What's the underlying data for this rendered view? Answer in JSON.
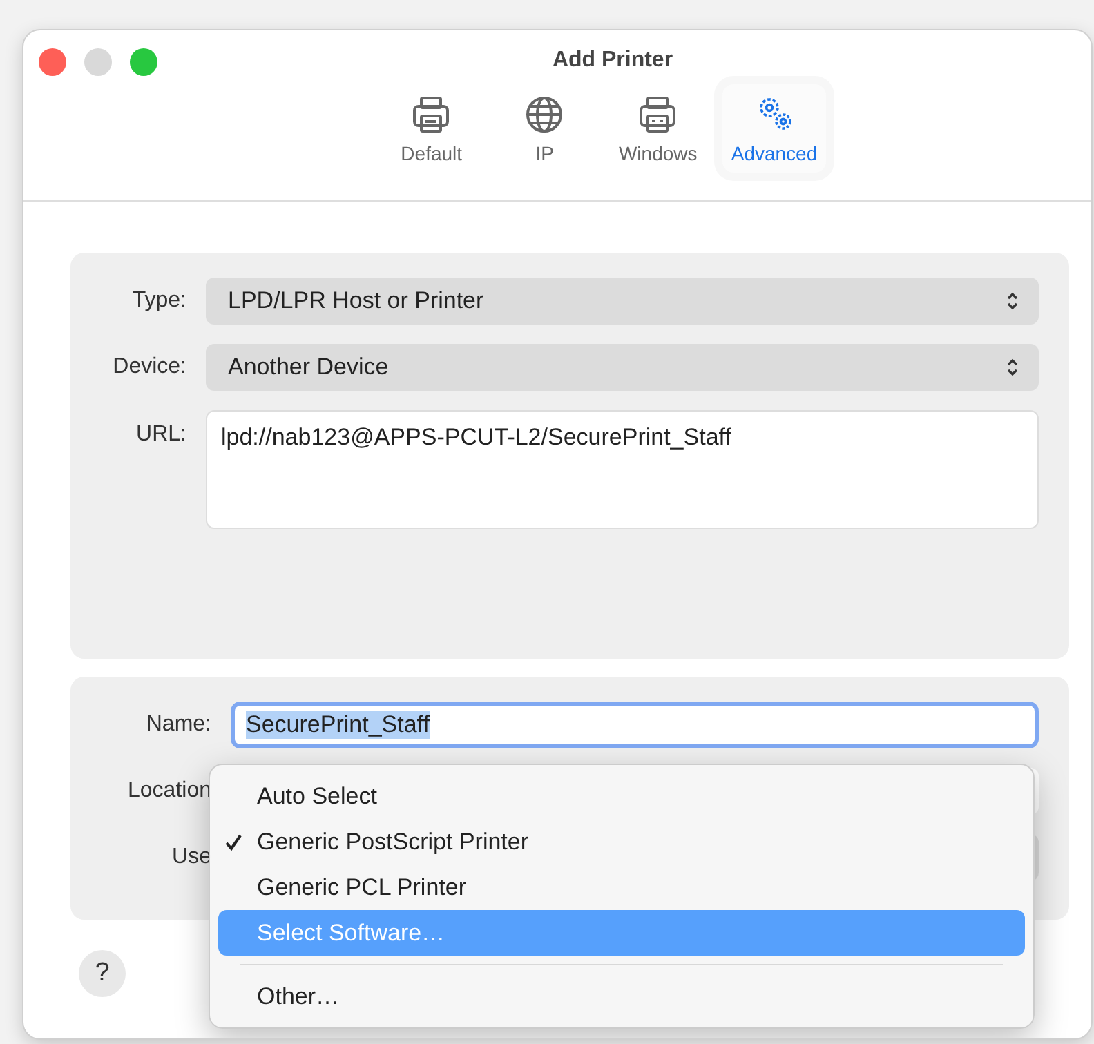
{
  "window": {
    "title": "Add Printer"
  },
  "tabs": [
    {
      "label": "Default",
      "selected": false
    },
    {
      "label": "IP",
      "selected": false
    },
    {
      "label": "Windows",
      "selected": false
    },
    {
      "label": "Advanced",
      "selected": true
    }
  ],
  "connection": {
    "type": {
      "label": "Type:",
      "value": "LPD/LPR Host or Printer"
    },
    "device": {
      "label": "Device:",
      "value": "Another Device"
    },
    "url": {
      "label": "URL:",
      "value": "lpd://nab123@APPS-PCUT-L2/SecurePrint_Staff"
    }
  },
  "details": {
    "name": {
      "label": "Name:",
      "value": "SecurePrint_Staff",
      "text_selected": true
    },
    "location": {
      "label": "Location"
    },
    "use": {
      "label": "Use"
    }
  },
  "menu": [
    {
      "kind": "option",
      "label": "Auto Select",
      "checked": false,
      "selected": false
    },
    {
      "kind": "option",
      "label": "Generic PostScript Printer",
      "checked": true,
      "selected": false
    },
    {
      "kind": "option",
      "label": "Generic PCL Printer",
      "checked": false,
      "selected": false
    },
    {
      "kind": "option",
      "label": "Select Software…",
      "checked": false,
      "selected": true
    },
    {
      "kind": "separator"
    },
    {
      "kind": "option",
      "label": "Other…",
      "checked": false,
      "selected": false
    }
  ],
  "help_button": {
    "label": "?"
  }
}
